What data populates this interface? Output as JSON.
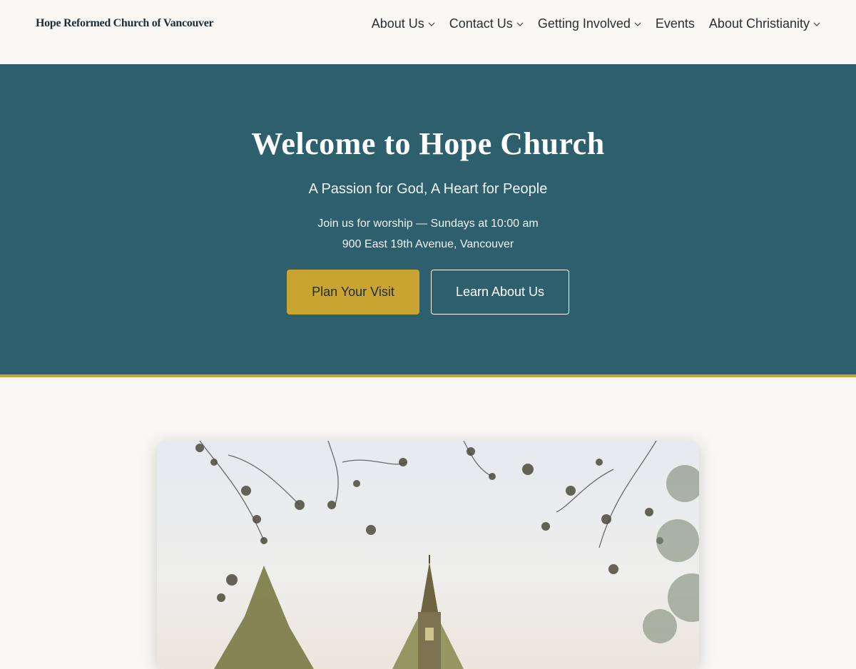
{
  "header": {
    "site_title": "Hope Reformed Church of Vancouver",
    "nav": [
      {
        "label": "About Us",
        "has_dropdown": true
      },
      {
        "label": "Contact Us",
        "has_dropdown": true
      },
      {
        "label": "Getting Involved",
        "has_dropdown": true
      },
      {
        "label": "Events",
        "has_dropdown": false
      },
      {
        "label": "About Christianity",
        "has_dropdown": true
      }
    ],
    "chevron_icon": "chevron-down-icon"
  },
  "hero": {
    "title": "Welcome to Hope Church",
    "tagline": "A Passion for God, A Heart for People",
    "worship_line": "Join us for worship — Sundays at 10:00 am",
    "address_line": "900 East 19th Avenue, Vancouver",
    "primary_button": "Plan Your Visit",
    "secondary_button": "Learn About Us"
  },
  "colors": {
    "background": "#f9f8f4",
    "hero_background": "#2d5f6d",
    "accent_gold": "#c9a430",
    "text_dark": "#1f2d36"
  },
  "photo": {
    "subject": "watercolor-style painting of church steeple among trees"
  }
}
